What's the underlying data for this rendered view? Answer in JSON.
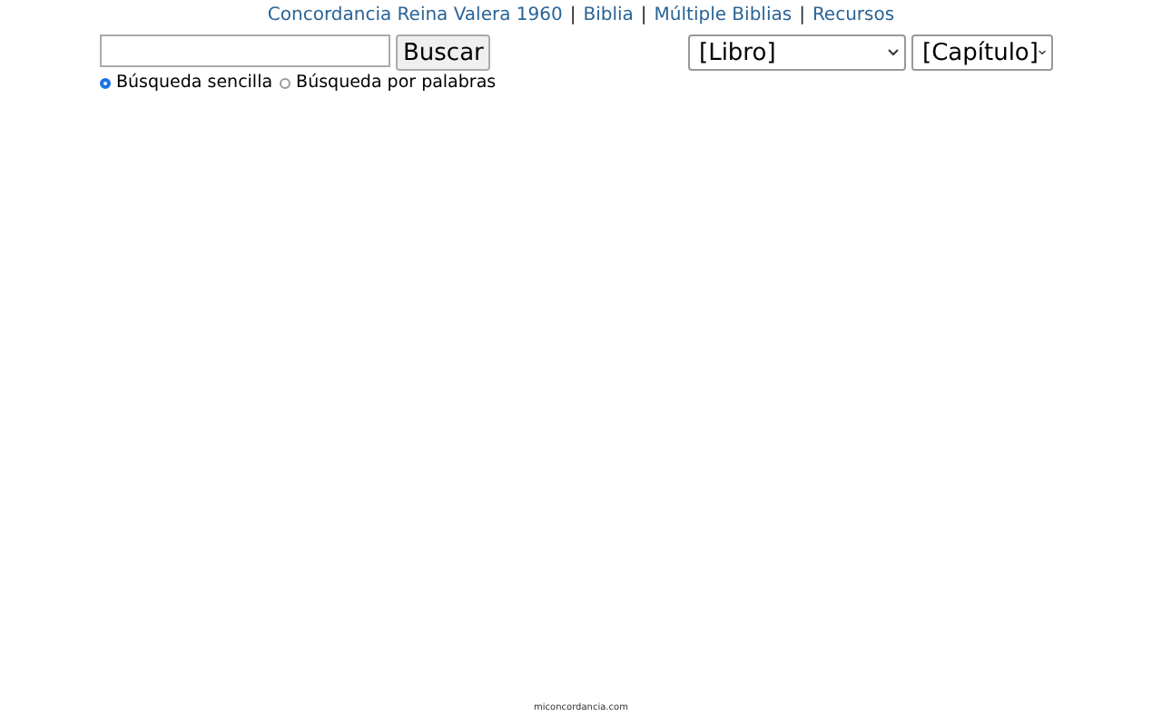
{
  "nav": {
    "links": [
      "Concordancia Reina Valera 1960",
      "Biblia",
      "Múltiple Biblias",
      "Recursos"
    ],
    "separator": "|"
  },
  "search": {
    "button": "Buscar",
    "modes": [
      {
        "label": "Búsqueda sencilla",
        "selected": true
      },
      {
        "label": "Búsqueda por palabras",
        "selected": false
      }
    ]
  },
  "selects": [
    "[Libro]",
    "[Capítulo]"
  ],
  "footer": "miconcordancia.com"
}
